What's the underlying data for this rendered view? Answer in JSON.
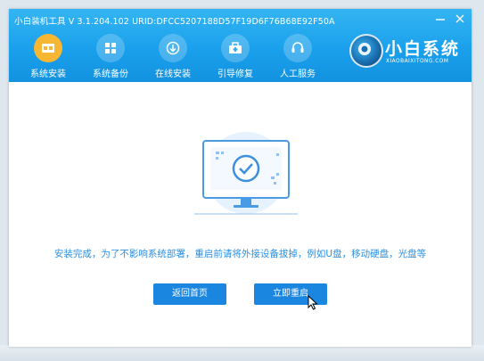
{
  "window": {
    "title": "小白装机工具 V 3.1.204.102 URID:DFCC5207188D57F19D6F76B68E92F50A",
    "minimize_icon": "minimize-icon",
    "close_icon": "close-icon"
  },
  "nav": {
    "items": [
      {
        "label": "系统安装",
        "icon": "system-install-icon",
        "active": true
      },
      {
        "label": "系统备份",
        "icon": "system-backup-icon",
        "active": false
      },
      {
        "label": "在线安装",
        "icon": "online-install-icon",
        "active": false
      },
      {
        "label": "引导修复",
        "icon": "boot-repair-icon",
        "active": false
      },
      {
        "label": "人工服务",
        "icon": "support-icon",
        "active": false
      }
    ],
    "active_color": "#f7b733"
  },
  "brand": {
    "name": "小白系统",
    "subtitle": "XIAOBAIXITONG.COM"
  },
  "main": {
    "message": "安装完成，为了不影响系统部署，重启前请将外接设备拔掉，例如U盘，移动硬盘，光盘等",
    "buttons": {
      "home": "返回首页",
      "restart": "立即重启"
    }
  },
  "colors": {
    "header": "#1aa0ec",
    "accent": "#1b86e0",
    "message": "#2a8fe0"
  }
}
